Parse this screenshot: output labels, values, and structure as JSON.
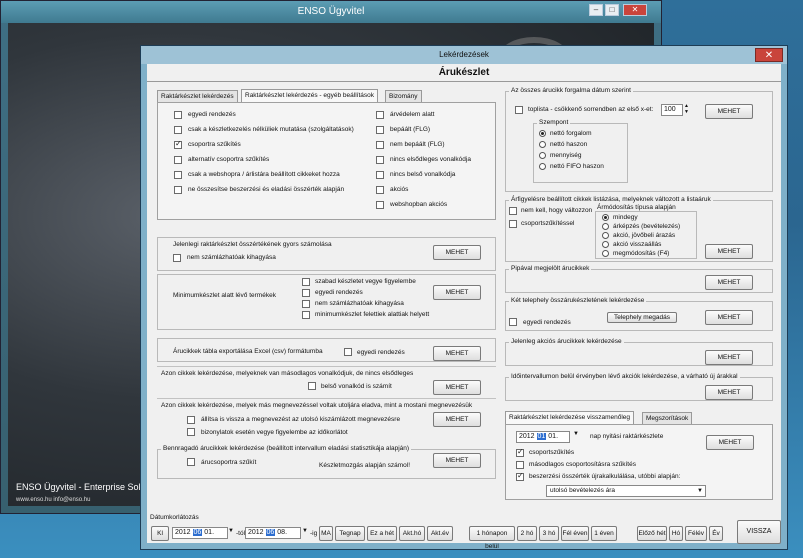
{
  "bg_window": {
    "title": "ENSO Ügyvitel",
    "brand": "ENSO Ügyvitel - Enterprise Solutions Kft.",
    "url": "www.enso.hu  info@enso.hu"
  },
  "dialog": {
    "title": "Lekérdezések",
    "heading": "Árukészlet",
    "close": "✕"
  },
  "tabs": [
    "Raktárkészlet lekérdezés",
    "Raktárkészlet lekérdezés - egyéb beállítások",
    "Bizomány"
  ],
  "options_left": [
    "egyedi rendezés",
    "csak a készletkezelés nélküliek mutatása (szolgáltatások)",
    "csoportra szűkítés",
    "alternatív csoportra szűkítés",
    "csak a webshopra / árlistára beállított cikkeket hozza",
    "ne összesítse beszerzési és eladási összérték alapján"
  ],
  "options_right": [
    "árvédelem alatt",
    "bepáált (FLG)",
    "nem bepáált (FLG)",
    "nincs elsődleges vonalkódja",
    "nincs belső vonalkódja",
    "akciós",
    "webshopban akciós"
  ],
  "sections": {
    "fast_value": {
      "title": "Jelenlegi raktárkészlet összértékének gyors számolása",
      "opt": "nem számlázhatóak kihagyása",
      "btn": "MEHET"
    },
    "min_stock": {
      "title": "Minimumkészlet alatt lévő termékek",
      "opts": [
        "szabad készletet vegye figyelembe",
        "egyedi rendezés",
        "nem számlázhatóak kihagyása",
        "minimumkészlet felettiek alattiak helyett"
      ],
      "btn": "MEHET"
    },
    "export": {
      "title": "Árucikkek tábla exportálása Excel (csv) formátumba",
      "opt": "egyedi rendezés",
      "btn": "MEHET"
    },
    "secondary": {
      "title": "Azon cikkek lekérdezése, melyeknek van másodlagos vonalkódjuk, de nincs elsődleges",
      "opt": "belső vonalkód is számít",
      "btn": "MEHET"
    },
    "priced": {
      "title": "Azon cikkek lekérdezése, melyek más megnevezéssel voltak utoljára eladva, mint a mostani megnevezésük",
      "opts": [
        "állítsa is vissza a megnevezést az utolsó kiszámlázott megnevezésre",
        "bizonylatok esetén vegye figyelembe az időkorlátot"
      ],
      "btn": "MEHET"
    },
    "shortage": {
      "title": "Bennragadó árucikkek lekérdezése (beállított intervallum eladási statisztikája alapján)",
      "opt": "árucsoportra szűkít",
      "note": "Készletmozgás alapján számol!",
      "btn": "MEHET"
    }
  },
  "right": {
    "turnover": {
      "title": "Az összes árucikk forgalma dátum szerint",
      "toplist": "toplista - csökkenő sorrendben az első x-et:",
      "count": "100",
      "group_title": "Szempont",
      "radios": [
        "nettó forgalom",
        "nettó haszon",
        "mennyiség",
        "nettó FIFO haszon"
      ],
      "btn": "MEHET"
    },
    "pricechange": {
      "title": "Árfigyelésre beállított cikkek listázása, melyeknek változott a listaáruk",
      "opts": [
        "nem kell, hogy változzon",
        "csoportszűkítéssel"
      ],
      "group_title": "Ármódosítás típusa alapján",
      "radios": [
        "mindegy",
        "árképzés (bevételezés)",
        "akció, jövőbeli árazás",
        "akció visszaállás",
        "megmódosítás (F4)"
      ],
      "btn": "MEHET"
    },
    "marked": {
      "title": "Pipával megjelölt árucikkek",
      "btn": "MEHET"
    },
    "twosite": {
      "title": "Két telephely összárukészletének lekérdezése",
      "opt": "egyedi rendezés",
      "site_btn": "Telephely megadás",
      "btn": "MEHET"
    },
    "current_promo": {
      "title": "Jelenleg akciós árucikkek lekérdezése",
      "btn": "MEHET"
    },
    "interval_promo": {
      "title": "Időintervallumon belül érvényben lévő akciók lekérdezése, a várható új árakkal",
      "btn": "MEHET"
    },
    "back_tabs": [
      "Raktárkészlet lekérdezése visszamenőleg",
      "Megszorítások"
    ],
    "back": {
      "date_y": "2012",
      "date_m": "01",
      "date_d": "01.",
      "date_label": "nap nyitási raktárkészlete",
      "opts": [
        "csoportszűkítés",
        "másodlagos csoportosításra szűkítés",
        "beszerzési összérték újrakalkulálása, utóbbi alapján:"
      ],
      "dropdown": "utolsó bevételezés ára",
      "btn": "MEHET"
    }
  },
  "footer": {
    "title": "Dátumkorlátozás",
    "kl": "Kl",
    "from_y": "2012",
    "from_m": "06",
    "from_d": "01.",
    "from_suffix": "-tól",
    "to_y": "2012",
    "to_m": "06",
    "to_d": "08.",
    "to_suffix": "-ig",
    "quick": [
      "MA",
      "Tegnap",
      "Ez a hét",
      "Akt.hó",
      "Akt.év"
    ],
    "range": [
      "1 hónapon belül",
      "2 hó",
      "3 hó",
      "Fél éven",
      "1 éven"
    ],
    "nav": [
      "Előző hét",
      "Hó",
      "Félév",
      "Év"
    ],
    "back": "VISSZA"
  }
}
